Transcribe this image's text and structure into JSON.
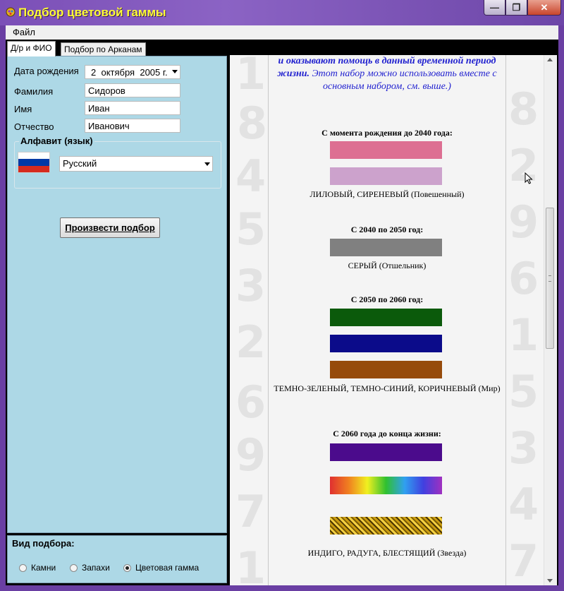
{
  "window": {
    "title": "Подбор цветовой гаммы",
    "min_glyph": "—",
    "max_glyph": "❐",
    "close_glyph": "✕"
  },
  "menu": {
    "file": "Файл"
  },
  "tabs": [
    {
      "label": "Д/р и ФИО",
      "active": true
    },
    {
      "label": "Подбор по Арканам",
      "active": false
    }
  ],
  "form": {
    "birthdate_label": "Дата рождения",
    "birthdate_day": "2",
    "birthdate_month": "октября",
    "birthdate_year": "2005 г.",
    "surname_label": "Фамилия",
    "surname_value": "Сидоров",
    "name_label": "Имя",
    "name_value": "Иван",
    "patronymic_label": "Отчество",
    "patronymic_value": "Иванович",
    "alphabet_group": "Алфавит (язык)",
    "language_value": "Русский",
    "run_button": "Произвести подбор",
    "flag_colors": [
      "#ffffff",
      "#0039a6",
      "#d52b1e"
    ]
  },
  "selection_mode": {
    "title": "Вид подбора:",
    "options": [
      {
        "label": "Камни",
        "selected": false
      },
      {
        "label": "Запахи",
        "selected": false
      },
      {
        "label": "Цветовая гамма",
        "selected": true
      }
    ]
  },
  "content": {
    "intro_bold": "и оказывают помощь в данный временной период жизни.",
    "intro_text": " Этот набор можно использовать вместе с основным набором, см. выше.)",
    "periods": [
      {
        "heading": "С момента рождения до 2040 года:",
        "colors": [
          "#dd6f92",
          "#cca2cc"
        ],
        "caption": "ЛИЛОВЫЙ, СИРЕНЕВЫЙ (Повешенный)"
      },
      {
        "heading": "С 2040 по 2050 год:",
        "colors": [
          "#808080"
        ],
        "caption": "СЕРЫЙ (Отшельник)"
      },
      {
        "heading": "С 2050 по 2060 год:",
        "colors": [
          "#0b5a0b",
          "#0b0b8a",
          "#964b0b"
        ],
        "caption": "ТЕМНО-ЗЕЛЕНЫЙ, ТЕМНО-СИНИЙ, КОРИЧНЕВЫЙ (Мир)"
      },
      {
        "heading": "С 2060 года до конца жизни:",
        "colors": [
          "#4b0b8c",
          "rainbow",
          "glitter"
        ],
        "caption": "ИНДИГО, РАДУГА, БЛЕСТЯЩИЙ (Звезда)"
      }
    ]
  }
}
